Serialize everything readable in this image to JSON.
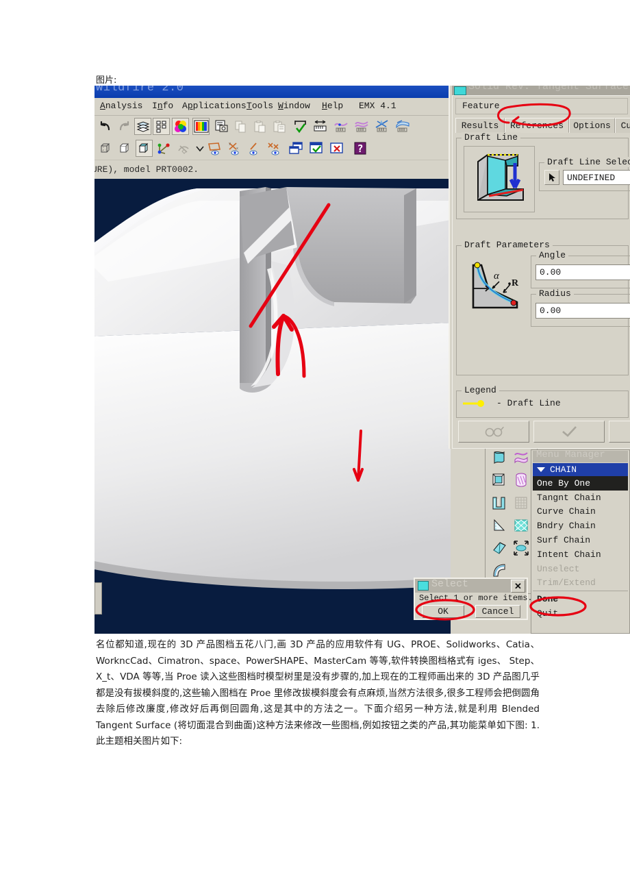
{
  "page": {
    "caption_label": "图片:"
  },
  "proe": {
    "title": "Wildfire 2.0",
    "menus": [
      {
        "label": "Analysis",
        "mnemonic": "A"
      },
      {
        "label": "Info",
        "mnemonic": "n"
      },
      {
        "label": "Applications",
        "mnemonic": "p"
      },
      {
        "label": "Tools",
        "mnemonic": "T"
      },
      {
        "label": "Window",
        "mnemonic": "W"
      },
      {
        "label": "Help",
        "mnemonic": "H"
      },
      {
        "label": "EMX 4.1",
        "mnemonic": ""
      }
    ],
    "toolbar_row1": [
      {
        "name": "undo-icon",
        "glyph": "↶"
      },
      {
        "name": "redo-icon",
        "glyph": "↷"
      },
      {
        "name": "layers-icon",
        "glyph": ""
      },
      {
        "name": "model-tree-icon",
        "glyph": ""
      },
      {
        "name": "color-appearance-icon",
        "glyph": ""
      },
      {
        "name": "color-spectrum-icon",
        "glyph": ""
      },
      {
        "name": "screen-capture-icon",
        "glyph": ""
      },
      {
        "name": "copy-icon",
        "glyph": ""
      },
      {
        "name": "paste-icon",
        "glyph": ""
      },
      {
        "name": "paste-special-icon",
        "glyph": ""
      },
      {
        "name": "regenerate-icon",
        "glyph": ""
      },
      {
        "name": "measure-icon",
        "glyph": ""
      },
      {
        "name": "curve-analysis-icon",
        "glyph": ""
      },
      {
        "name": "surface-analysis-icon",
        "glyph": ""
      },
      {
        "name": "curvature-plot-icon",
        "glyph": ""
      },
      {
        "name": "surface-curvature-icon",
        "glyph": ""
      }
    ],
    "toolbar_row2": [
      {
        "name": "wireframe-icon",
        "glyph": ""
      },
      {
        "name": "hidden-line-icon",
        "glyph": ""
      },
      {
        "name": "shaded-icon",
        "glyph": ""
      },
      {
        "name": "datum-axes-icon",
        "glyph": ""
      },
      {
        "name": "spin-center-off-icon",
        "glyph": ""
      },
      {
        "name": "dropdown-arrow-icon",
        "glyph": "⌄"
      },
      {
        "name": "datum-plane-display-icon",
        "glyph": ""
      },
      {
        "name": "datum-axis-display-icon",
        "glyph": ""
      },
      {
        "name": "datum-point-display-icon",
        "glyph": ""
      },
      {
        "name": "coord-sys-display-icon",
        "glyph": ""
      },
      {
        "name": "new-window-icon",
        "glyph": ""
      },
      {
        "name": "accept-window-icon",
        "glyph": ""
      },
      {
        "name": "close-window-icon",
        "glyph": "✕"
      },
      {
        "name": "help-icon",
        "glyph": "?"
      }
    ],
    "message_line": "URE), model PRT0002.",
    "viewport": {
      "background": "#081c3f",
      "model_name": "PRT0002"
    }
  },
  "icon_palette": [
    {
      "name": "surface-free-form-icon"
    },
    {
      "name": "style-curve-icon"
    },
    {
      "name": "offset-surface-icon"
    },
    {
      "name": "cylindrical-pattern-icon"
    },
    {
      "name": "draft-surface-icon"
    },
    {
      "name": "grid-disabled-icon"
    },
    {
      "name": "cone-surface-icon"
    },
    {
      "name": "mesh-surface-icon"
    },
    {
      "name": "blend-surface-icon"
    },
    {
      "name": "transform-surface-icon"
    },
    {
      "name": "fillet-surface-icon"
    }
  ],
  "feature_dialog": {
    "title": "Solid Rev: Tangent Surface",
    "feature_label": "Feature",
    "tabs": [
      {
        "label": "Results",
        "active": false
      },
      {
        "label": "References",
        "active": true
      },
      {
        "label": "Options",
        "active": false
      },
      {
        "label": "Curves",
        "active": false
      }
    ],
    "draft_line_group": "Draft Line",
    "draft_line_selection_group": "Draft Line Selection",
    "draft_line_selection_value": "UNDEFINED",
    "draft_parameters_group": "Draft Parameters",
    "angle_group": "Angle",
    "angle_value": "0.00",
    "radius_group": "Radius",
    "radius_value": "0.00",
    "legend_group": "Legend",
    "legend_entry": "- Draft Line",
    "legend_color": "#ffef00",
    "buttons": [
      {
        "name": "preview-button",
        "glyph": "👓"
      },
      {
        "name": "accept-button",
        "glyph": "✓"
      },
      {
        "name": "cancel-button",
        "glyph": "✕"
      }
    ]
  },
  "menu_manager": {
    "title": "Menu Manager",
    "header": "CHAIN",
    "items": [
      {
        "label": "One By One",
        "state": "selected"
      },
      {
        "label": "Tangnt Chain",
        "state": "normal"
      },
      {
        "label": "Curve Chain",
        "state": "normal"
      },
      {
        "label": "Bndry Chain",
        "state": "normal"
      },
      {
        "label": "Surf Chain",
        "state": "normal"
      },
      {
        "label": "Intent Chain",
        "state": "normal"
      },
      {
        "label": "Unselect",
        "state": "disabled"
      },
      {
        "label": "Trim/Extend",
        "state": "disabled"
      },
      {
        "label": "Done",
        "state": "bold"
      },
      {
        "label": "Quit",
        "state": "normal"
      }
    ]
  },
  "select_dialog": {
    "title": "Select",
    "message": "Select 1 or more items.",
    "ok_label": "OK",
    "cancel_label": "Cancel",
    "close_label": "✕"
  },
  "annotations": {
    "color": "#e60012",
    "marks": [
      {
        "name": "references-tab-circle",
        "shape": "ellipse"
      },
      {
        "name": "draft-line-arrow",
        "shape": "arrow-up"
      },
      {
        "name": "downward-arrow",
        "shape": "arrow-down"
      },
      {
        "name": "done-circle",
        "shape": "ellipse"
      },
      {
        "name": "ok-circle",
        "shape": "ellipse"
      }
    ]
  },
  "article": {
    "paragraph": "名位都知道,现在的 3D 产品图档五花八门,画 3D 产品的应用软件有 UG、PROE、Solidworks、Catia、WorkncCad、Cimatron、space、PowerSHAPE、MasterCam 等等,软件转换图档格式有 iges、 Step、 X_t、VDA 等等,当 Proe 读入这些图档时模型树里是没有步骤的,加上现在的工程师画出来的 3D 产品图几乎都是没有拔模斜度的,这些输入图档在 Proe 里修改拔模斜度会有点麻烦,当然方法很多,很多工程师会把倒圆角去除后修改廉度,修改好后再倒回圆角,这是其中的方法之一。下面介绍另一种方法,就是利用 Blended Tangent Surface (将切面混合到曲面)这种方法来修改一些图档,例如按钮之类的产品,其功能菜单如下图: 1.此主题相关图片如下:"
  }
}
